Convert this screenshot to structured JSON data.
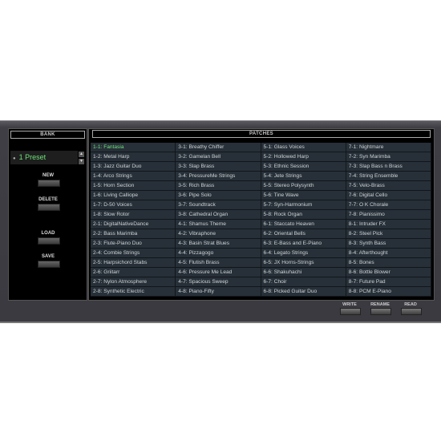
{
  "bank": {
    "title": "BANK",
    "selected": "1 Preset",
    "buttons": [
      "NEW",
      "DELETE",
      "LOAD",
      "SAVE"
    ]
  },
  "patches": {
    "title": "PATCHES",
    "selected": "1-1: Fantasia",
    "items": [
      "1-1: Fantasia",
      "1-2: Metal Harp",
      "1-3: Jazz Guitar Duo",
      "1-4: Arco Strings",
      "1-5: Horn Section",
      "1-6: Living Calliope",
      "1-7: D-50 Voices",
      "1-8: Slow Rotor",
      "2-1: DigitalNativeDance",
      "2-2: Bass Marimba",
      "2-3: Flute-Piano Duo",
      "2-4: Combie Strings",
      "2-5: Harpsichord Stabs",
      "2-6: Griitarr",
      "2-7: Nylon Atmosphere",
      "2-8: Synthetic Electric",
      "3-1: Breathy Chiffer",
      "3-2: Gamelan Bell",
      "3-3: Slap Brass",
      "3-4: PressureMe Strings",
      "3-5: Rich Brass",
      "3-6: Pipe Solo",
      "3-7: Soundtrack",
      "3-8: Cathedral Organ",
      "4-1: Shamus Theme",
      "4-2: Vibraphone",
      "4-3: Basin Strat Blues",
      "4-4: Pizzagogo",
      "4-5: Flutish Brass",
      "4-6: Pressure Me Lead",
      "4-7: Spacious Sweep",
      "4-8: Piano-Fifty",
      "5-1: Glass Voices",
      "5-2: Hollowed Harp",
      "5-3: Ethnic Session",
      "5-4: Jete Strings",
      "5-5: Stereo Polysynth",
      "5-6: Tine Wave",
      "5-7: Syn-Harmonium",
      "5-8: Rock Organ",
      "6-1: Staccato Heaven",
      "6-2: Oriental Bells",
      "6-3: E-Bass and E-Piano",
      "6-4: Legato Strings",
      "6-5: JX Horns-Strings",
      "6-6: Shakuhachi",
      "6-7: Choir",
      "6-8: Picked Guitar Duo",
      "7-1: Nightmare",
      "7-2: Syn Marimba",
      "7-3: Slap Bass n Brass",
      "7-4: String Ensemble",
      "7-5: Velo-Brass",
      "7-6: Digital Cello",
      "7-7: O K  Chorale",
      "7-8: Pianissimo",
      "8-1: Intruder FX",
      "8-2: Steel Pick",
      "8-3: Synth Bass",
      "8-4: Afterthought",
      "8-5: Bones",
      "8-6: Bottle Blower",
      "8-7: Future Pad",
      "8-8: PCM E-Piano"
    ]
  },
  "footer": {
    "buttons": [
      "WRITE",
      "RENAME",
      "READ"
    ]
  },
  "colors": {
    "selected": "#6ee07a",
    "cell": "#273038",
    "frame": "#3e3e44"
  }
}
